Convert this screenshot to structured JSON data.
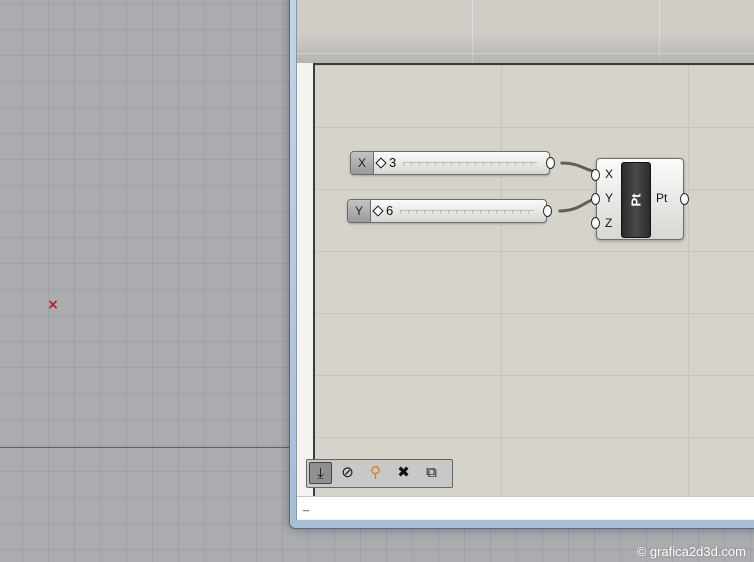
{
  "viewport": {
    "point_marker": "×"
  },
  "watermark": "© grafica2d3d.com",
  "canvas": {
    "sliders": [
      {
        "name": "X",
        "value": "3"
      },
      {
        "name": "Y",
        "value": "6"
      }
    ],
    "point_component": {
      "core_label": "Pt",
      "inputs": [
        "X",
        "Y",
        "Z"
      ],
      "output": "Pt"
    }
  },
  "toolbar": {
    "buttons": [
      {
        "icon": "download-icon",
        "glyph": "⤓"
      },
      {
        "icon": "clip-icon",
        "glyph": "⊘"
      },
      {
        "icon": "pin-icon",
        "glyph": "⚲"
      },
      {
        "icon": "close-hex-icon",
        "glyph": "✖"
      },
      {
        "icon": "window-stack-icon",
        "glyph": "⧉"
      }
    ]
  },
  "status": {
    "text": "_"
  },
  "colors": {
    "viewport_bg": "#aaacaf",
    "canvas_bg": "#d6d3cb",
    "axis_red": "#b5383b",
    "marker_red": "#c0171c"
  }
}
